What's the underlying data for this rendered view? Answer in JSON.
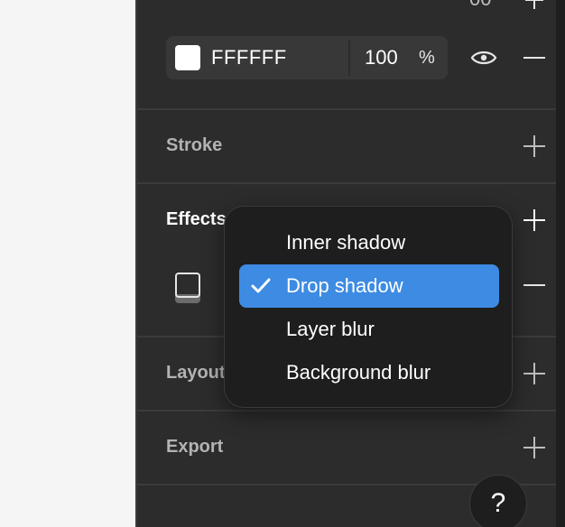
{
  "top_partial_value": "00",
  "fill": {
    "color_hex": "FFFFFF",
    "opacity": "100",
    "opacity_unit": "%",
    "swatch_color": "#ffffff"
  },
  "sections": {
    "stroke": "Stroke",
    "effects": "Effects",
    "layout": "Layout",
    "export": "Export"
  },
  "effects_menu": {
    "items": [
      {
        "label": "Inner shadow",
        "selected": false
      },
      {
        "label": "Drop shadow",
        "selected": true
      },
      {
        "label": "Layer blur",
        "selected": false
      },
      {
        "label": "Background blur",
        "selected": false
      }
    ]
  },
  "help": {
    "label": "?"
  },
  "colors": {
    "panel_bg": "#2c2c2c",
    "menu_bg": "#1e1e1e",
    "accent": "#3d8be2",
    "canvas_bg": "#f5f5f5"
  }
}
